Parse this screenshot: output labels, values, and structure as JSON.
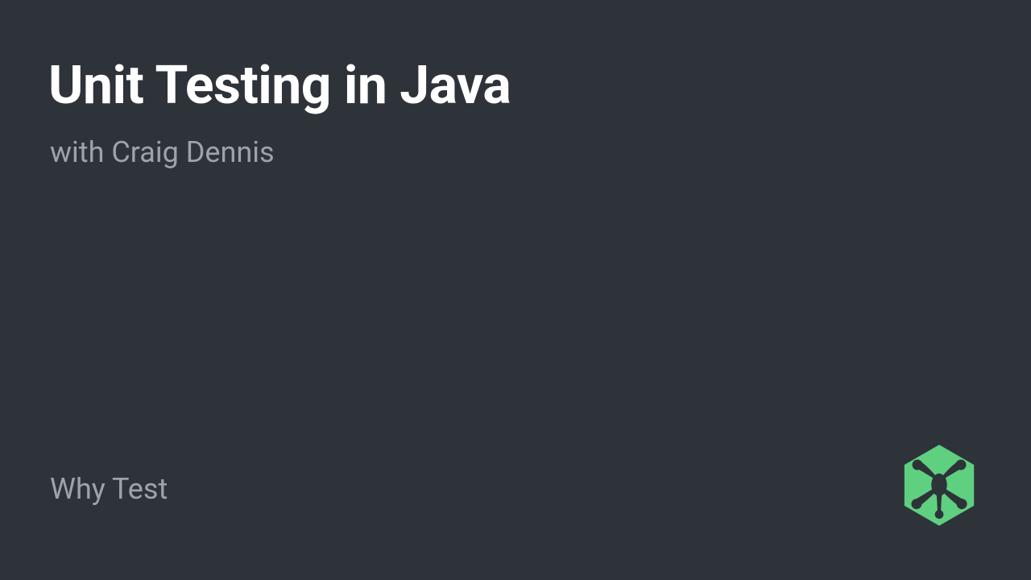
{
  "slide": {
    "title": "Unit Testing in Java",
    "subtitle": "with Craig Dennis",
    "footer": "Why Test"
  },
  "colors": {
    "background": "#2d3339",
    "title": "#ffffff",
    "subtitle": "#9da3a9",
    "accent": "#5fcf80"
  }
}
